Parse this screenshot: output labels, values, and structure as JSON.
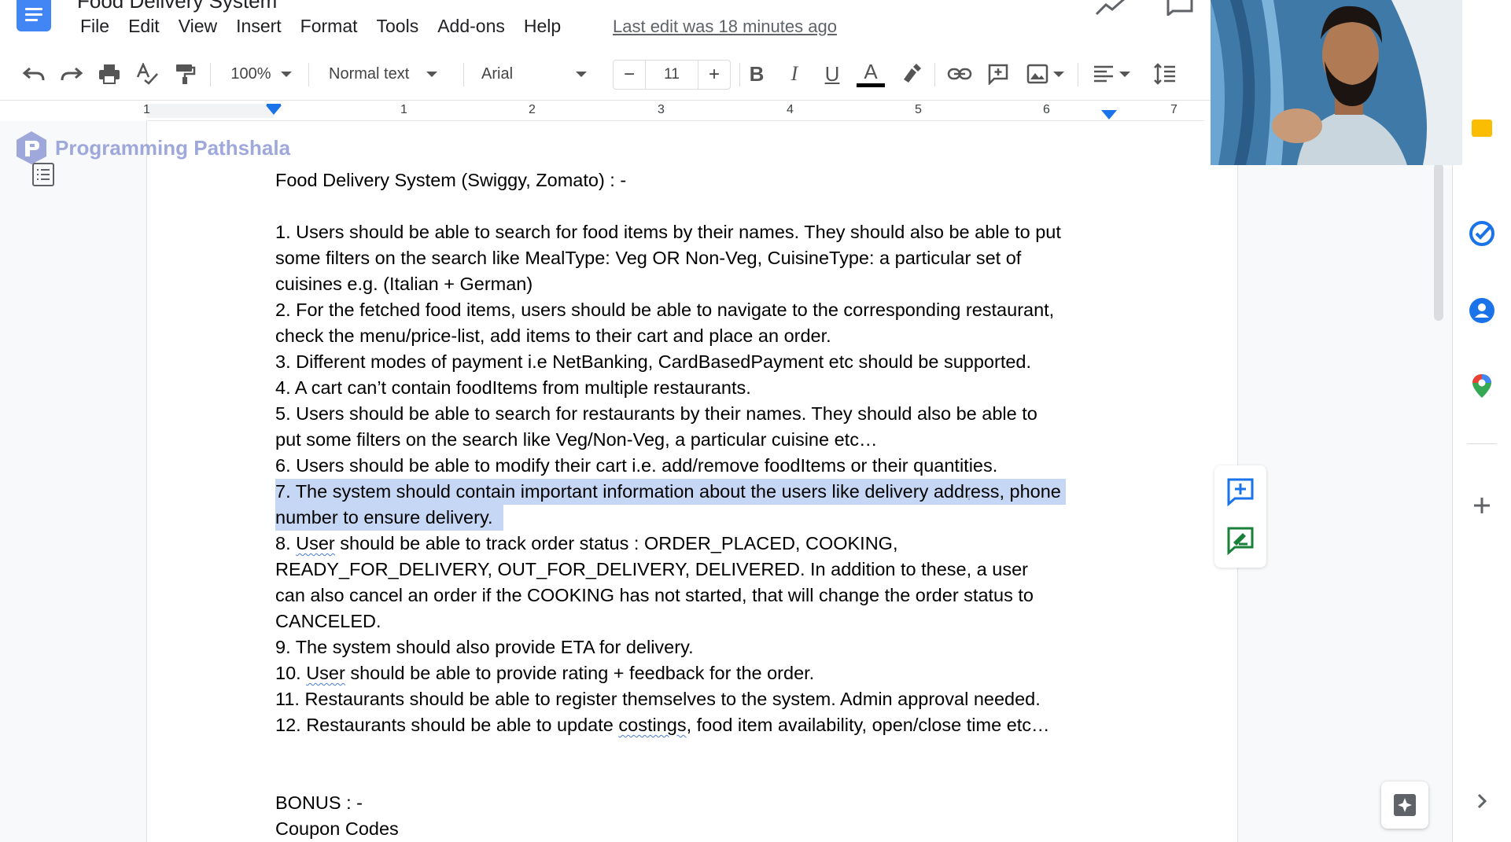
{
  "app": {
    "title": "Food Delivery System",
    "menu": [
      "File",
      "Edit",
      "View",
      "Insert",
      "Format",
      "Tools",
      "Add-ons",
      "Help"
    ],
    "last_edit": "Last edit was 18 minutes ago"
  },
  "toolbar": {
    "zoom": "100%",
    "style": "Normal text",
    "font": "Arial",
    "font_size": "11",
    "minus": "−",
    "plus": "+",
    "bold": "B",
    "italic": "I",
    "underline": "U",
    "text_color": "A",
    "text_color_hex": "#000000"
  },
  "ruler": {
    "numbers": [
      "1",
      "1",
      "2",
      "3",
      "4",
      "5",
      "6",
      "7"
    ]
  },
  "watermark": {
    "text": "Programming Pathshala",
    "color": "#9fa8da"
  },
  "document": {
    "heading": "Food Delivery System (Swiggy, Zomato) : -",
    "items": [
      {
        "lines": [
          "1. Users should be able to search for food items by their names. They should also be able to put",
          "some filters on the search like MealType: Veg OR Non-Veg, CuisineType: a particular set of",
          "cuisines e.g. (Italian + German)"
        ]
      },
      {
        "lines": [
          "2. For the fetched food items, users should be able to navigate to the corresponding restaurant,",
          "check the menu/price-list, add items to their cart and place an order."
        ]
      },
      {
        "lines": [
          "3. Different modes of payment i.e NetBanking, CardBasedPayment etc should be supported."
        ]
      },
      {
        "lines": [
          "4. A cart can’t contain foodItems from multiple restaurants."
        ]
      },
      {
        "lines": [
          "5. Users should be able to search for restaurants by their names. They should also be able to",
          "put some filters on the search like Veg/Non-Veg, a particular cuisine etc…"
        ]
      },
      {
        "lines": [
          "6. Users should be able to modify their cart i.e. add/remove foodItems or their quantities."
        ]
      },
      {
        "selected": true,
        "lines": [
          "7. The system should contain important information about the users like delivery address, phone",
          "number to ensure delivery."
        ]
      },
      {
        "lines": [
          "8. User should be able to track order status : ORDER_PLACED, COOKING,",
          "READY_FOR_DELIVERY, OUT_FOR_DELIVERY, DELIVERED. In addition to these, a user",
          "can also cancel an order if the COOKING has not started, that will change the order status to",
          "CANCELED."
        ]
      },
      {
        "lines": [
          "9. The system should also provide ETA for delivery."
        ]
      },
      {
        "lines": [
          "10. User should be able to provide rating + feedback for the order."
        ]
      },
      {
        "lines": [
          "11. Restaurants should be able to register themselves to the system. Admin approval needed."
        ]
      },
      {
        "lines": [
          "12. Restaurants should be able to update costings, food item availability, open/close time etc…"
        ]
      }
    ],
    "bonus_heading": "BONUS : -",
    "bonus_line": "Coupon Codes",
    "selection_color": "#c6d7f5"
  },
  "colors": {
    "accent": "#1a73e8",
    "docs_blue": "#4285f4"
  },
  "icons": {
    "toolbar": [
      "undo-icon",
      "redo-icon",
      "print-icon",
      "spellcheck-icon",
      "paint-format-icon",
      "highlight-icon",
      "link-icon",
      "insert-comment-icon",
      "insert-image-icon",
      "align-icon",
      "line-spacing-icon"
    ],
    "addon_panel": [
      "keep-icon",
      "tasks-icon",
      "contacts-icon",
      "maps-icon",
      "add-addon-icon",
      "expand-panel-icon"
    ]
  }
}
